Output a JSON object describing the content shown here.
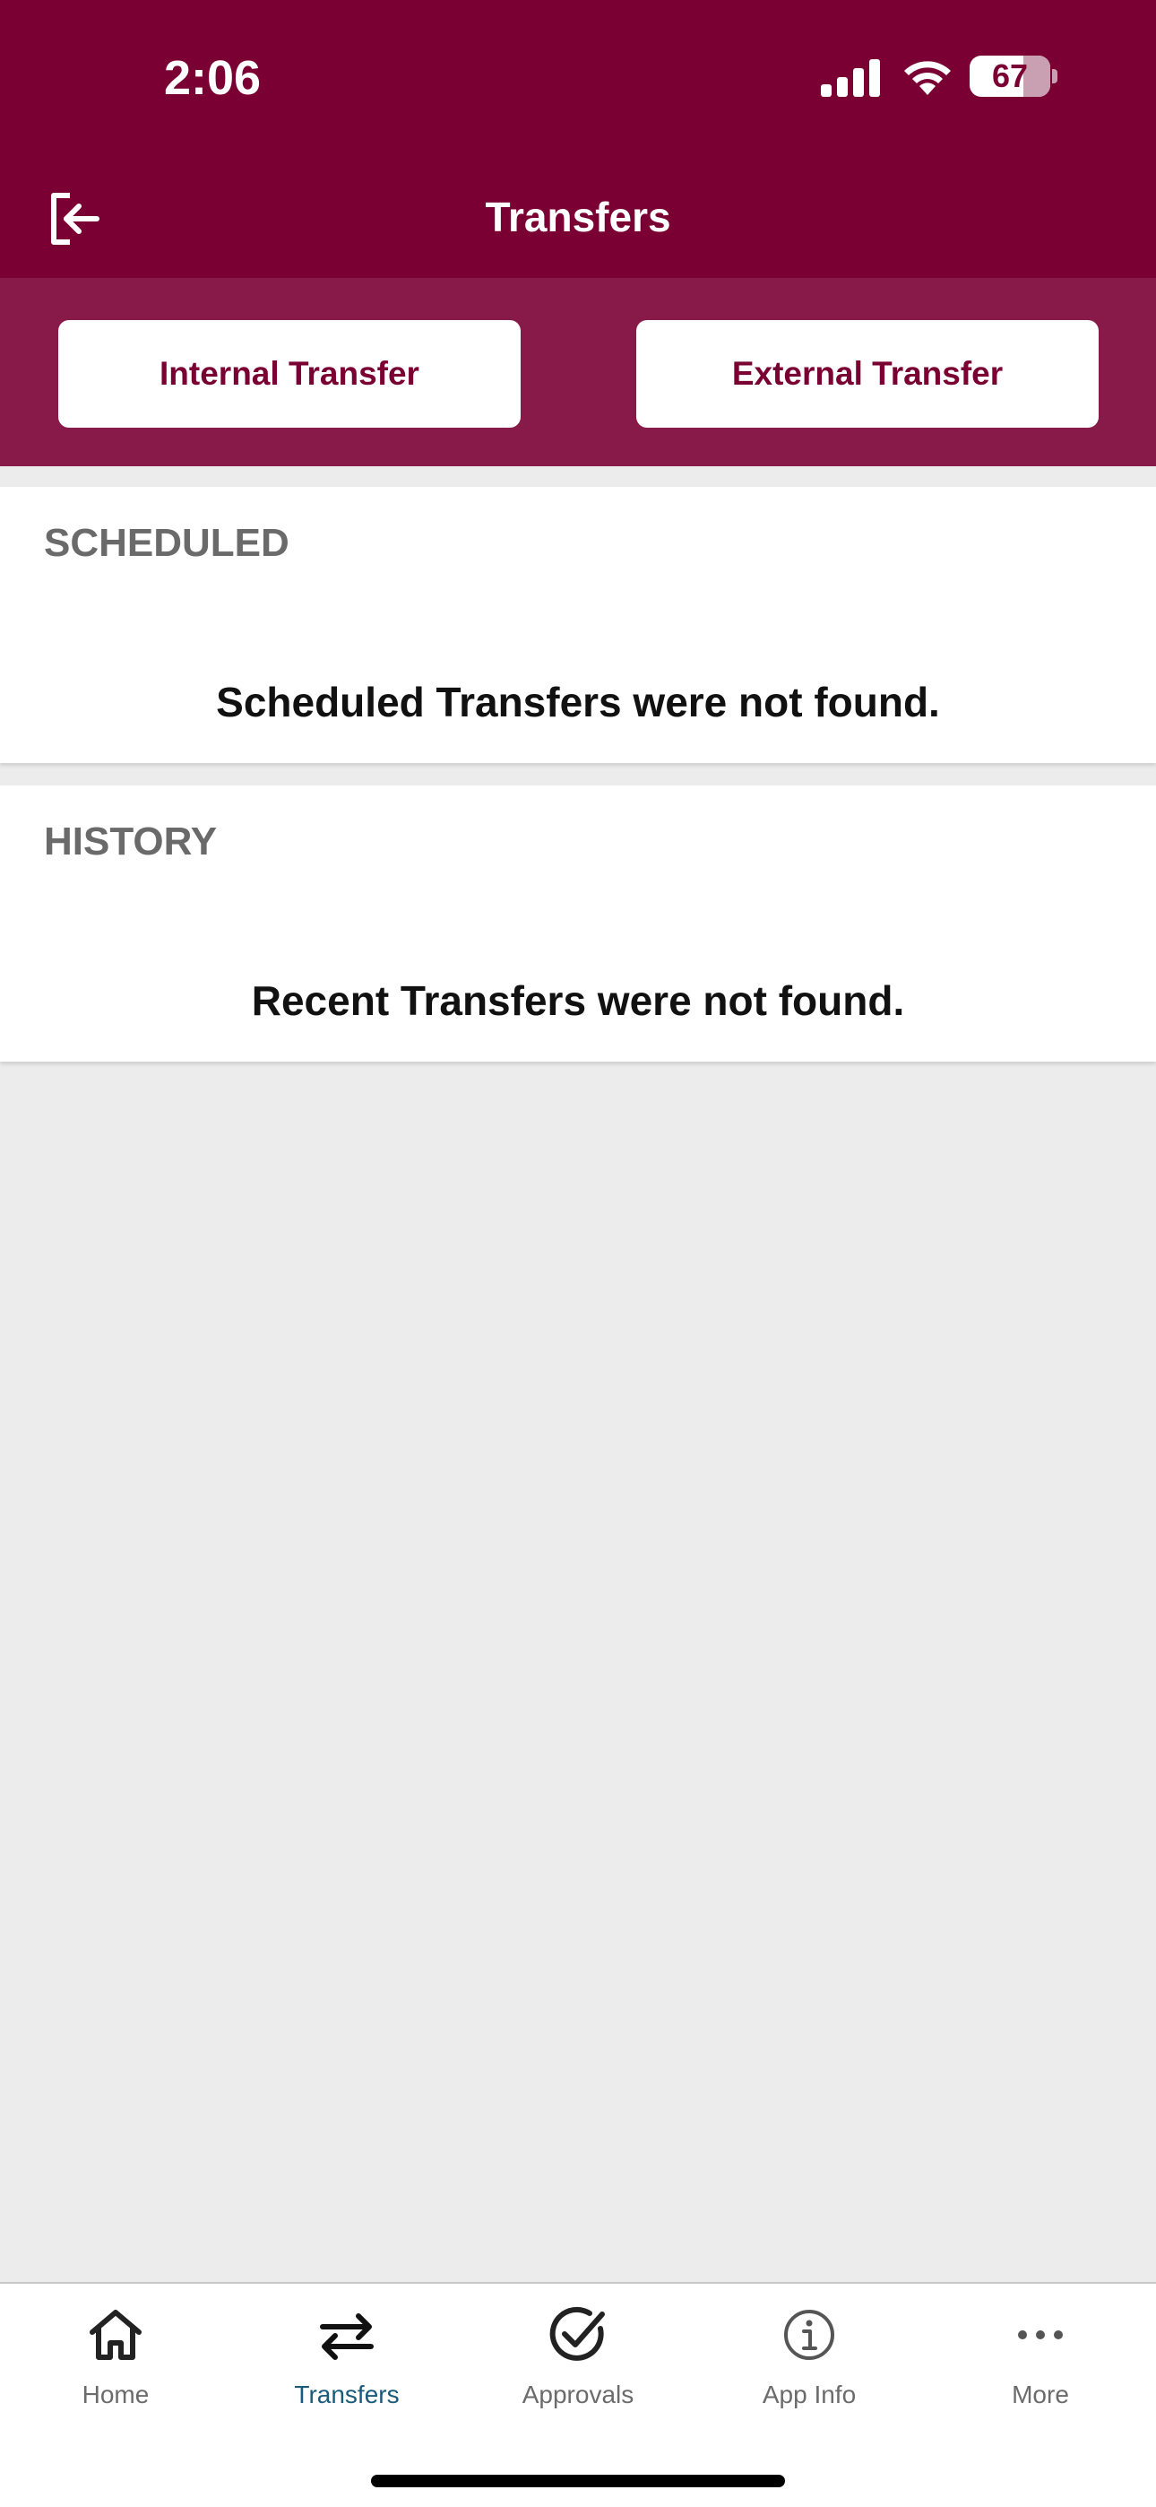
{
  "status_bar": {
    "time": "2:06",
    "battery": "67",
    "battery_level": 0.67
  },
  "header": {
    "title": "Transfers",
    "logout_icon": "logout-icon",
    "background_color": "#7a0033"
  },
  "actions": {
    "internal_label": "Internal Transfer",
    "external_label": "External Transfer",
    "strip_color": "#871a48"
  },
  "scheduled": {
    "heading": "SCHEDULED",
    "empty_message": "Scheduled Transfers were not found."
  },
  "history": {
    "heading": "HISTORY",
    "empty_message": "Recent Transfers were not found."
  },
  "tab_bar": {
    "active_color": "#1a5a7a",
    "items": [
      {
        "label": "Home",
        "icon": "home-icon"
      },
      {
        "label": "Transfers",
        "icon": "transfer-arrows-icon",
        "active": true
      },
      {
        "label": "Approvals",
        "icon": "check-circle-icon"
      },
      {
        "label": "App Info",
        "icon": "info-icon"
      },
      {
        "label": "More",
        "icon": "more-dots-icon"
      }
    ]
  }
}
